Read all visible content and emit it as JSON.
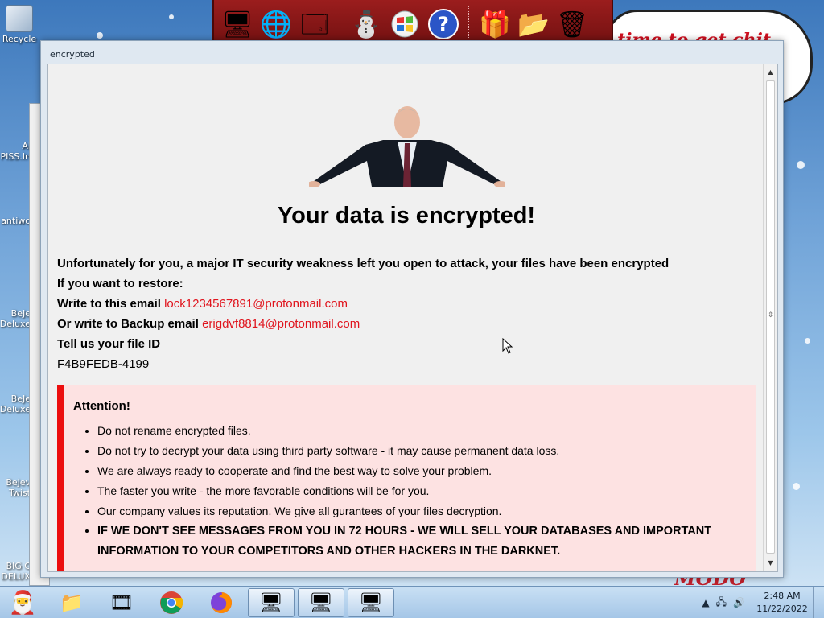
{
  "desktop": {
    "icons": [
      {
        "label": "Recycle",
        "icon": "recycle-bin-icon"
      },
      {
        "label": "Al\nPISS.In",
        "icon": "file-icon"
      },
      {
        "label": "antiwo",
        "icon": "file-icon"
      },
      {
        "label": "BeJe\nDeluxe",
        "icon": "game-icon"
      },
      {
        "label": "BeJe\nDeluxe",
        "icon": "game-icon"
      },
      {
        "label": "Bejev\nTwist",
        "icon": "game-icon"
      },
      {
        "label": "BIG C\nDELUX",
        "icon": "game-icon"
      }
    ],
    "bubble_text": "time to get chit",
    "bottom_text": "MODO"
  },
  "toolbar": {
    "icons": [
      "santa-computer-icon",
      "globe-icon",
      "control-panel-icon",
      "snowman-icon",
      "windows-logo-icon",
      "help-icon",
      "gift-icon",
      "folder-icon",
      "recycle-bin-icon"
    ]
  },
  "window": {
    "title": "encrypted",
    "headline": "Your data is encrypted!",
    "intro": "Unfortunately for you, a major IT security weakness left you open to attack, your files have been encrypted",
    "restore_label": "If you want to restore:",
    "email_label": "Write to this email",
    "email": "lock1234567891@protonmail.com",
    "backup_label": "Or write to Backup email",
    "backup_email": "erigdvf8814@protonmail.com",
    "file_id_label": "Tell us your file ID",
    "file_id": "F4B9FEDB-4199",
    "attention": {
      "title": "Attention!",
      "items": [
        "Do not rename encrypted files.",
        "Do not try to decrypt your data using third party software - it may cause permanent data loss.",
        "We are always ready to cooperate and find the best way to solve your problem.",
        "The faster you write - the more favorable conditions will be for you.",
        "Our company values its reputation. We give all gurantees of your files decryption.",
        "IF WE DON'T SEE MESSAGES FROM YOU IN 72 HOURS - WE WILL SELL YOUR DATABASES AND IMPORTANT INFORMATION TO YOUR COMPETITORS AND OTHER HACKERS IN THE DARKNET."
      ]
    },
    "colors": {
      "accent": "#ec0e0e",
      "email": "#e0141d",
      "attention_bg": "#fde2e2"
    }
  },
  "taskbar": {
    "items": [
      {
        "name": "start-button",
        "icon": "santa-icon"
      },
      {
        "name": "file-manager",
        "icon": "folder-icon"
      },
      {
        "name": "media-player",
        "icon": "video-icon"
      },
      {
        "name": "chrome",
        "icon": "chrome-icon"
      },
      {
        "name": "firefox",
        "icon": "firefox-icon"
      },
      {
        "name": "app-1",
        "icon": "computer-icon"
      },
      {
        "name": "app-2",
        "icon": "computer-icon"
      },
      {
        "name": "app-3",
        "icon": "computer-icon"
      }
    ],
    "time": "2:48 AM",
    "date": "11/22/2022"
  }
}
